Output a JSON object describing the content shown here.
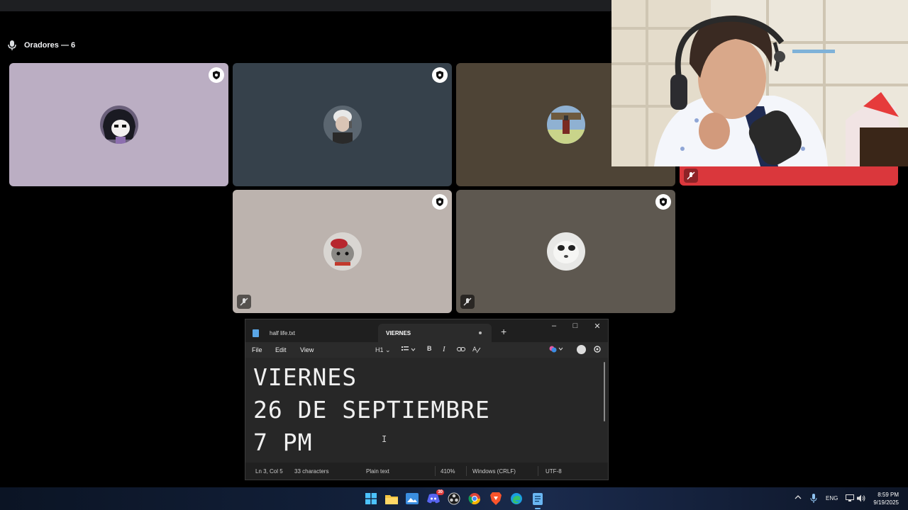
{
  "stage": {
    "title": "Oradores — 6"
  },
  "tiles": [
    {
      "id": "speaker-1",
      "bg": "#bbaec3",
      "muted": false
    },
    {
      "id": "speaker-2",
      "bg": "#36414b",
      "muted": false
    },
    {
      "id": "speaker-3",
      "bg": "#4e4436",
      "muted": false
    },
    {
      "id": "speaker-4",
      "bg": "#bcb3ae",
      "muted": true
    },
    {
      "id": "speaker-5",
      "bg": "#5e5850",
      "muted": true
    }
  ],
  "notepad": {
    "tabs": [
      {
        "label": "half life.txt",
        "active": false
      },
      {
        "label": "VIERNES",
        "active": true,
        "unsaved": true
      }
    ],
    "new_tab": "+",
    "window_controls": {
      "minimize": "–",
      "maximize": "□",
      "close": "✕"
    },
    "menu": {
      "file": "File",
      "edit": "Edit",
      "view": "View"
    },
    "toolbar": {
      "heading": "H1",
      "bold": "B",
      "italic": "I"
    },
    "lines": [
      "VIERNES",
      "26 DE SEPTIEMBRE",
      "7 PM"
    ],
    "status": {
      "position": "Ln 3, Col 5",
      "characters": "33 characters",
      "format": "Plain text",
      "zoom": "410%",
      "line_ending": "Windows (CRLF)",
      "encoding": "UTF-8"
    }
  },
  "taskbar": {
    "language": "ENG",
    "time": "8:59 PM",
    "date": "9/19/2025",
    "discord_badge": "30"
  }
}
